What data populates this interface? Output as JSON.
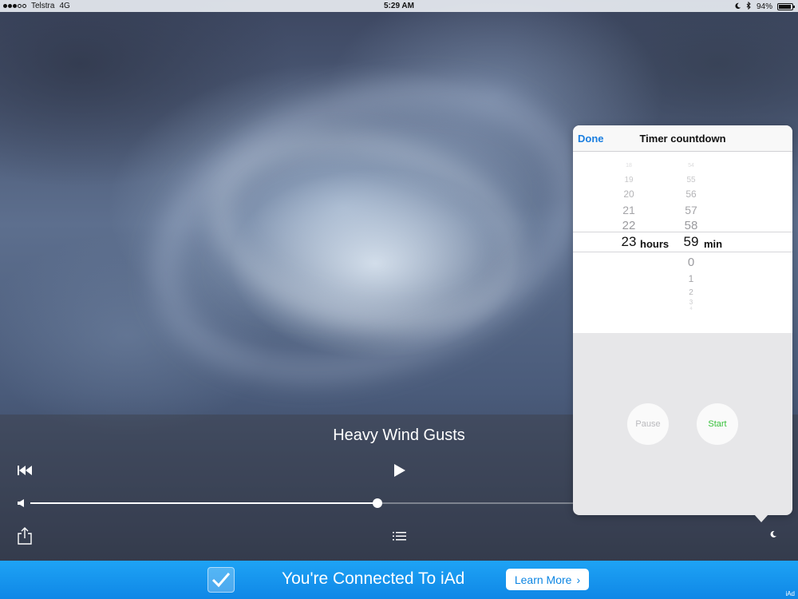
{
  "status_bar": {
    "carrier": "Telstra",
    "network": "4G",
    "time": "5:29 AM",
    "battery": "94%",
    "battery_level": 0.94,
    "signal_dots": 5,
    "signal_filled": 3
  },
  "player": {
    "title": "Heavy Wind Gusts",
    "volume_level": 0.64,
    "icons": {
      "rewind": "rewind-icon",
      "play": "play-icon",
      "volume": "speaker-icon",
      "share": "share-icon",
      "playlist": "list-icon",
      "sleep": "moon-icon"
    }
  },
  "timer": {
    "done_label": "Done",
    "title": "Timer countdown",
    "hours_above": [
      "18",
      "19",
      "20",
      "21",
      "22"
    ],
    "hours_selected": "23",
    "hours_unit": "hours",
    "mins_above": [
      "54",
      "55",
      "56",
      "57",
      "58"
    ],
    "mins_selected": "59",
    "mins_unit": "min",
    "mins_below": [
      "0",
      "1",
      "2",
      "3",
      "4"
    ],
    "pause_label": "Pause",
    "start_label": "Start"
  },
  "ad": {
    "message": "You're Connected To iAd",
    "cta": "Learn More",
    "cta_chevron": "›",
    "label": "iAd"
  },
  "colors": {
    "accent_blue": "#1a7ee0",
    "start_green": "#38c13b",
    "ad_blue": "#1398ee"
  }
}
